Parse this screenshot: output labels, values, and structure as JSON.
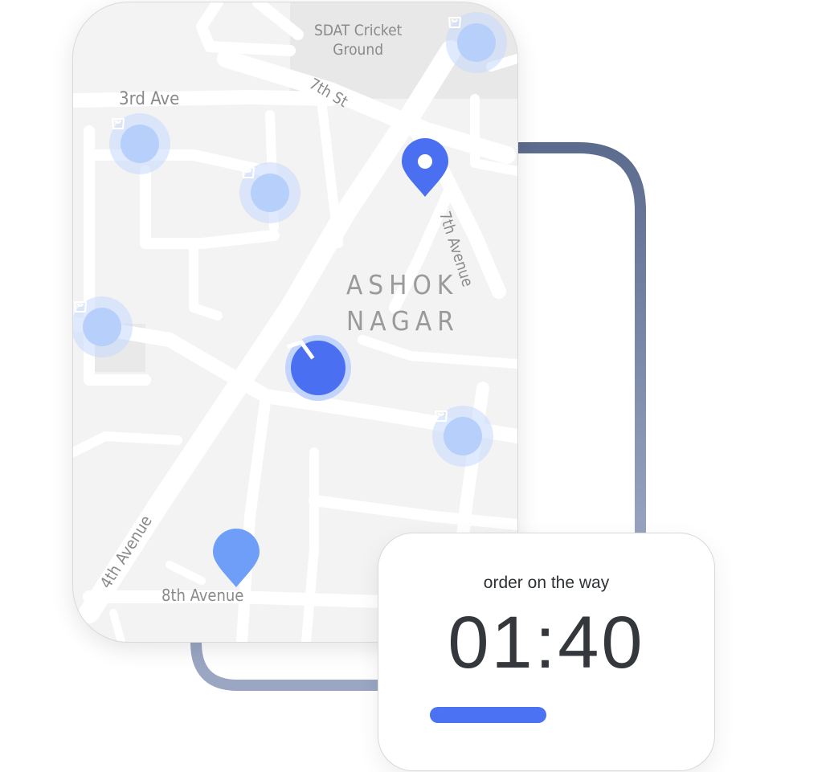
{
  "map": {
    "labels": {
      "third_ave": "3rd Ave",
      "sdat_line1": "SDAT Cricket",
      "sdat_line2": "Ground",
      "seventh_st": "7th St",
      "seventh_avenue": "7th Avenue",
      "district_line1": "ASHOK",
      "district_line2": "NAGAR",
      "fourth_avenue": "4th Avenue",
      "eighth_avenue": "8th Avenue"
    },
    "icons": {
      "store": "shopping-bag-icon",
      "destination": "location-pin-icon",
      "origin": "location-pin-icon",
      "courier": "navigation-arrow-icon"
    },
    "colors": {
      "accent": "#4a6ff0",
      "store_pin": "#b7cffb",
      "origin_pin": "#6f9ef9",
      "map_bg": "#f3f3f3",
      "road": "#ffffff",
      "connector_top": "#5c6c8e",
      "connector_bottom": "#9aa6c2"
    }
  },
  "order": {
    "status": "order on the way",
    "timer": "01:40",
    "progress": 0.5
  }
}
